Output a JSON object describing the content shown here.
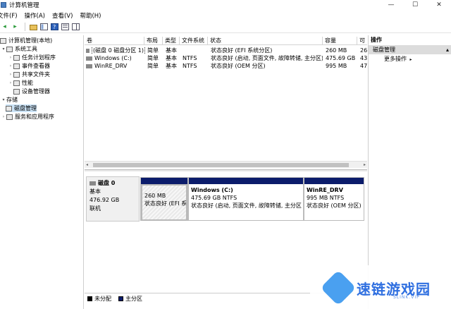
{
  "window": {
    "title": "计算机管理",
    "controls": [
      "—",
      "☐",
      "✕"
    ]
  },
  "menu": [
    "文件(F)",
    "操作(A)",
    "查看(V)",
    "帮助(H)"
  ],
  "tree": {
    "root": "计算机管理(本地)",
    "items": [
      {
        "label": "系统工具",
        "level": 1
      },
      {
        "label": "任务计划程序",
        "level": 2
      },
      {
        "label": "事件查看器",
        "level": 2
      },
      {
        "label": "共享文件夹",
        "level": 2
      },
      {
        "label": "性能",
        "level": 2
      },
      {
        "label": "设备管理器",
        "level": 2
      },
      {
        "label": "存储",
        "level": 1
      },
      {
        "label": "磁盘管理",
        "level": 2,
        "selected": true
      },
      {
        "label": "服务和应用程序",
        "level": 1
      }
    ]
  },
  "volumes": {
    "headers": [
      "卷",
      "布局",
      "类型",
      "文件系统",
      "状态",
      "容量",
      "可"
    ],
    "rows": [
      {
        "name": "(磁盘 0 磁盘分区 1)",
        "layout": "简单",
        "type": "基本",
        "fs": "",
        "status": "状态良好 (EFI 系统分区)",
        "capacity": "260 MB",
        "free": "26"
      },
      {
        "name": "Windows (C:)",
        "layout": "简单",
        "type": "基本",
        "fs": "NTFS",
        "status": "状态良好 (启动, 页面文件, 故障转储, 主分区)",
        "capacity": "475.69 GB",
        "free": "43"
      },
      {
        "name": "WinRE_DRV",
        "layout": "简单",
        "type": "基本",
        "fs": "NTFS",
        "status": "状态良好 (OEM 分区)",
        "capacity": "995 MB",
        "free": "47"
      }
    ]
  },
  "disk": {
    "name": "磁盘 0",
    "kind": "基本",
    "size": "476.92 GB",
    "state": "联机",
    "partitions": [
      {
        "name": "",
        "size": "260 MB",
        "status": "状态良好 (EFI 系"
      },
      {
        "name": "Windows (C:)",
        "size": "475.69 GB NTFS",
        "status": "状态良好 (启动, 页面文件, 故障转储, 主分区"
      },
      {
        "name": "WinRE_DRV",
        "size": "995 MB NTFS",
        "status": "状态良好 (OEM 分区)"
      }
    ]
  },
  "legend": [
    {
      "label": "未分配",
      "color": "#000000"
    },
    {
      "label": "主分区",
      "color": "#0b1c6b"
    }
  ],
  "actions": {
    "title": "操作",
    "section": "磁盘管理",
    "more": "更多操作"
  },
  "watermark": {
    "text": "速链游戏园",
    "sub": "SLINK.VIP"
  }
}
